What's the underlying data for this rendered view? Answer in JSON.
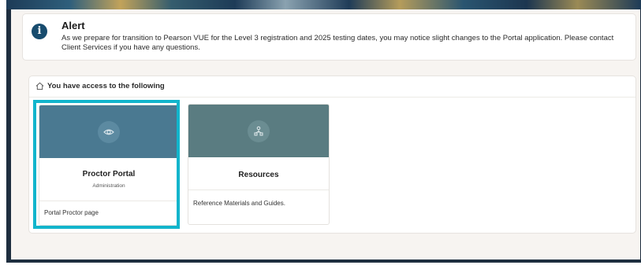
{
  "alert": {
    "title": "Alert",
    "icon": "info-icon",
    "message": "As we prepare for transition to Pearson VUE for the Level 3 registration and 2025 testing dates, you may notice slight changes to the Portal application. Please contact Client Services if you have any questions."
  },
  "access": {
    "icon": "home-icon",
    "title": "You have access to the following"
  },
  "cards": [
    {
      "icon": "eye-icon",
      "title": "Proctor Portal",
      "subtitle": "Administration",
      "description": "Portal Proctor page",
      "hero_color": "#4a7991",
      "circle_color": "#5c8aa1"
    },
    {
      "icon": "resources-icon",
      "title": "Resources",
      "subtitle": "",
      "description": "Reference Materials and Guides.",
      "hero_color": "#5a7c81",
      "circle_color": "#6b8d92"
    }
  ],
  "colors": {
    "highlight": "#12b5cc",
    "info": "#184c6e"
  }
}
